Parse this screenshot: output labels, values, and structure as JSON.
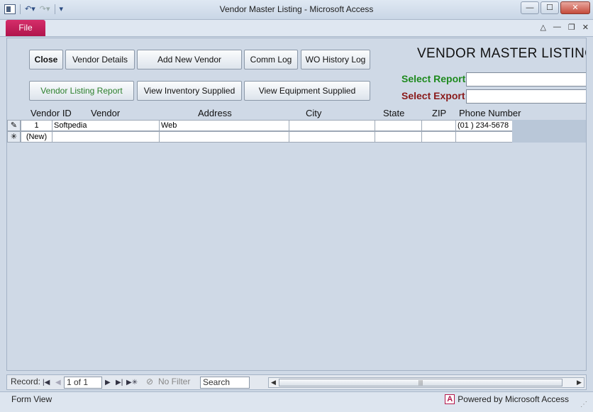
{
  "window": {
    "title": "Vendor Master Listing  -  Microsoft Access",
    "minimize": "—",
    "maximize": "☐",
    "close": "✕"
  },
  "ribbon": {
    "file_tab": "File",
    "ctrl_collapse": "△",
    "ctrl_min": "—",
    "ctrl_restore": "❐",
    "ctrl_close": "✕"
  },
  "form": {
    "title": "VENDOR MASTER LISTING",
    "buttons": {
      "close": "Close",
      "vendor_details": "Vendor Details",
      "add_new_vendor": "Add New Vendor",
      "comm_log": "Comm Log",
      "wo_history_log": "WO History Log",
      "vendor_listing_report": "Vendor Listing Report",
      "view_inventory_supplied": "View Inventory Supplied",
      "view_equipment_supplied": "View Equipment Supplied"
    },
    "select_report_label": "Select Report",
    "select_export_label": "Select Export",
    "select_report_value": "",
    "select_export_value": "",
    "colors": {
      "report_label": "#1e8a1e",
      "export_label": "#8a1a1a",
      "green_button_text": "#2b7f2b"
    }
  },
  "grid": {
    "headers": [
      "Vendor ID",
      "Vendor",
      "Address",
      "City",
      "State",
      "ZIP",
      "Phone Number"
    ],
    "rows": [
      {
        "selector_icon": "pencil-icon",
        "vendor_id": "1",
        "vendor": "Softpedia",
        "address": "Web",
        "city": "",
        "state": "",
        "zip": "",
        "phone": "(01 ) 234-5678"
      }
    ],
    "new_row": {
      "selector_icon": "new-record-asterisk-icon",
      "label": "(New)"
    }
  },
  "navigation": {
    "record_label": "Record:",
    "position": "1 of 1",
    "filter": "No Filter",
    "search_placeholder": "Search"
  },
  "status": {
    "view": "Form View",
    "powered_by": "Powered by Microsoft Access"
  }
}
